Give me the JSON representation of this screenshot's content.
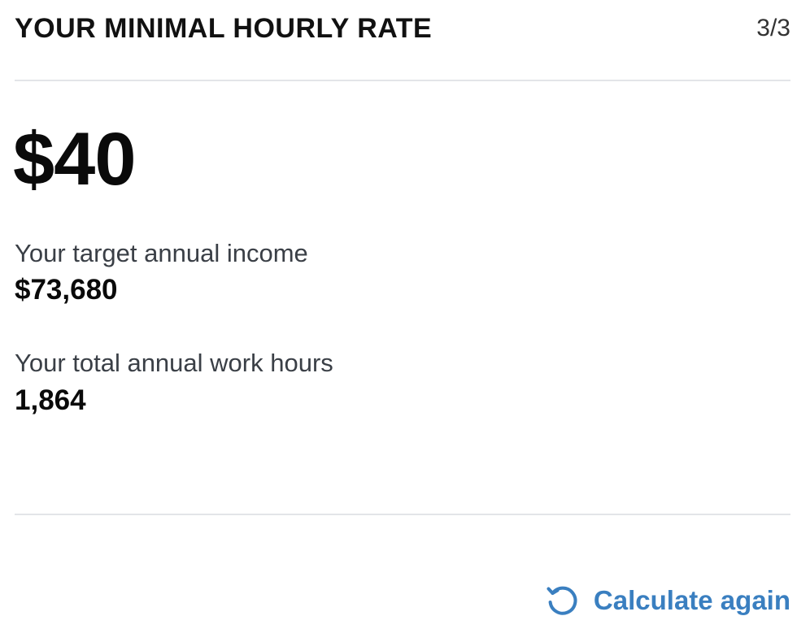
{
  "header": {
    "title": "YOUR MINIMAL HOURLY RATE",
    "step": "3/3"
  },
  "result": {
    "hourly_rate": "$40"
  },
  "metrics": {
    "income_label": "Your target annual income",
    "income_value": "$73,680",
    "hours_label": "Your total annual work hours",
    "hours_value": "1,864"
  },
  "actions": {
    "calculate_again_label": "Calculate again",
    "calculate_again_icon": "refresh-icon",
    "accent_color": "#3a7fc0"
  }
}
